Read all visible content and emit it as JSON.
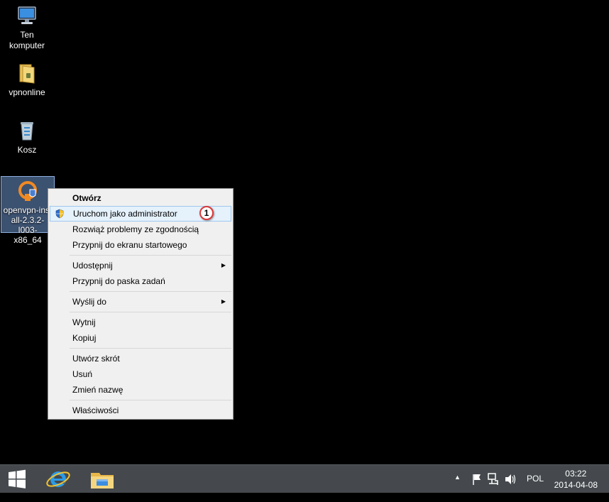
{
  "desktop": {
    "icons": [
      {
        "name": "Ten komputer",
        "line1": "Ten",
        "line2": "komputer"
      },
      {
        "name": "vpnonline"
      },
      {
        "name": "Kosz"
      },
      {
        "line1": "openvpn-inst",
        "line2": "all-2.3.2-I003-",
        "line3": "x86_64"
      }
    ]
  },
  "context_menu": {
    "items": [
      {
        "label": "Otwórz"
      },
      {
        "label": "Uruchom jako administrator",
        "badge": "1"
      },
      {
        "label": "Rozwiąż problemy ze zgodnością"
      },
      {
        "label": "Przypnij do ekranu startowego"
      },
      {
        "label": "Udostępnij",
        "arrow": "▶"
      },
      {
        "label": "Przypnij do paska zadań"
      },
      {
        "label": "Wyślij do",
        "arrow": "▶"
      },
      {
        "label": "Wytnij"
      },
      {
        "label": "Kopiuj"
      },
      {
        "label": "Utwórz skrót"
      },
      {
        "label": "Usuń"
      },
      {
        "label": "Zmień nazwę"
      },
      {
        "label": "Właściwości"
      }
    ]
  },
  "taskbar": {
    "tray_arrow": "▲",
    "language": "POL",
    "time": "03:22",
    "date": "2014-04-08"
  },
  "colors": {
    "taskbar": "#45494d",
    "menu_bg": "#f0f0f0",
    "highlight": "#e5f1fb",
    "badge_border": "#d93a3a"
  }
}
